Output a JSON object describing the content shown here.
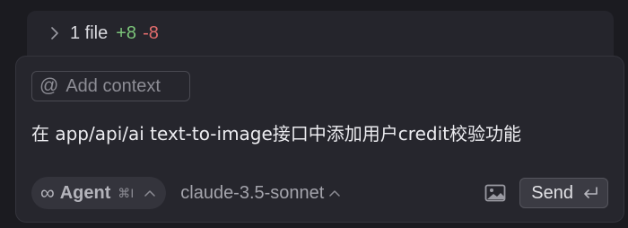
{
  "changes": {
    "file_count": "1 file",
    "added": "+8",
    "removed": "-8",
    "expand_icon": "chevron-right-icon"
  },
  "composer": {
    "add_context_icon": "at-sign-icon",
    "add_context_label": "Add context",
    "prompt_text": "在 app/api/ai text-to-image接口中添加用户credit校验功能",
    "mode": {
      "icon": "infinity-icon",
      "label": "Agent",
      "shortcut": "⌘I"
    },
    "model": "claude-3.5-sonnet",
    "image_icon": "image-icon",
    "send_label": "Send",
    "send_icon": "enter-key-icon"
  },
  "colors": {
    "background": "#1b1b20",
    "panel": "#26262d",
    "added": "#7cc57a",
    "removed": "#e06c6c"
  }
}
